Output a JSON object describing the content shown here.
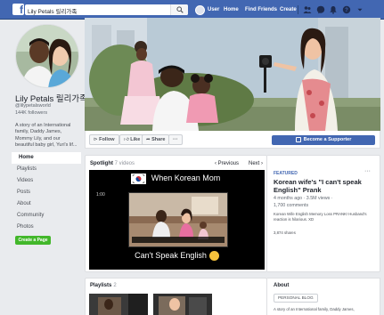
{
  "topbar": {
    "logo": "f",
    "search_value": "Lily Petals 릴리가족",
    "user_label": "User",
    "home_label": "Home",
    "find_friends_label": "Find Friends",
    "create_label": "Create",
    "brand_color": "#4267b2"
  },
  "profile": {
    "name": "Lily Petals 릴리가족",
    "handle": "@lilypetalsworld",
    "followers": "144K followers",
    "description": "A story of an International family, Daddy James, Mommy Lily, and our beautiful baby girl, Yuri's lif..."
  },
  "sidebar": {
    "items": [
      {
        "label": "Home",
        "active": true
      },
      {
        "label": "Playlists",
        "active": false
      },
      {
        "label": "Videos",
        "active": false
      },
      {
        "label": "Posts",
        "active": false
      },
      {
        "label": "About",
        "active": false
      },
      {
        "label": "Community",
        "active": false
      },
      {
        "label": "Photos",
        "active": false
      }
    ],
    "create_page_label": "Create a Page"
  },
  "actions": {
    "follow_label": "Follow",
    "like_label": "Like",
    "share_label": "Share",
    "more_label": "···",
    "supporter_label": "Become a Supporter"
  },
  "spotlight": {
    "title": "Spotlight",
    "count": "7 videos",
    "prev_label": "Previous",
    "next_label": "Next",
    "video_top_text": "When Korean Mom",
    "video_bottom_text": "Can't Speak English",
    "video_time": "1:00"
  },
  "featured": {
    "label": "FEATURED",
    "more": "···",
    "title": "Korean wife's \"I can't speak English\" Prank",
    "meta_line1": "4 months ago · 3.5M views ·",
    "meta_line2": "1,700 comments",
    "description": "Korean Wife English Memory Loss PRANK! Husband's reaction is hilarious. XD",
    "shares": "3,874 shares"
  },
  "playlists": {
    "title": "Playlists",
    "count": "2"
  },
  "about": {
    "title": "About",
    "badge": "PERSONAL BLOG",
    "text": "A story of an International family, Daddy James,"
  }
}
